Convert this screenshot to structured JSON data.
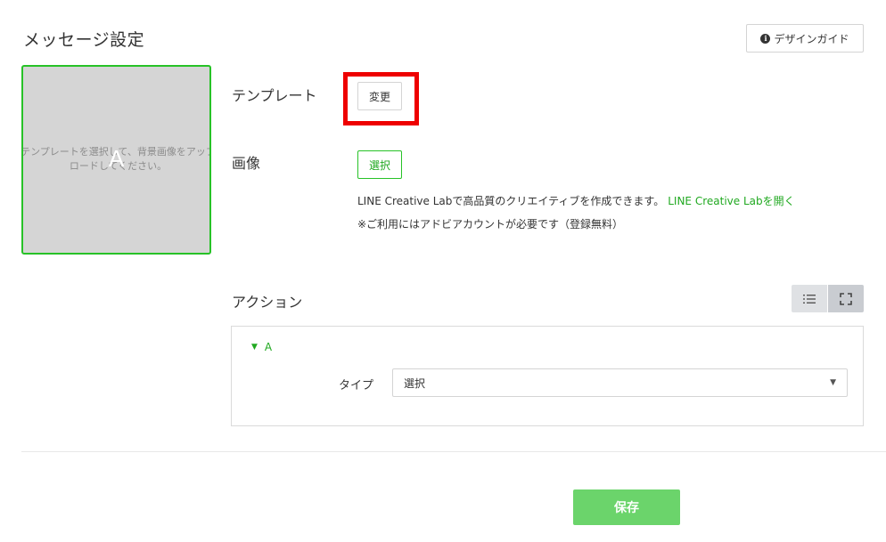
{
  "header": {
    "title": "メッセージ設定",
    "design_guide_label": "デザインガイド",
    "design_guide_icon": "info-icon"
  },
  "preview": {
    "hint": "テンプレートを選択して、背景画像をアップロードしてください。",
    "area_letter": "A"
  },
  "template": {
    "label": "テンプレート",
    "change_label": "変更"
  },
  "image": {
    "label": "画像",
    "select_label": "選択",
    "info_text": "LINE Creative Labで高品質のクリエイティブを作成できます。",
    "info_link": "LINE Creative Labを開く",
    "note": "※ご利用にはアドビアカウントが必要です（登録無料）"
  },
  "action": {
    "label": "アクション",
    "view_list_icon": "list-icon",
    "view_fullscreen_icon": "fullscreen-icon",
    "areas": [
      {
        "name": "A",
        "type_label": "タイプ",
        "type_value": "選択"
      }
    ]
  },
  "footer": {
    "save_label": "保存"
  },
  "colors": {
    "accent": "#27c227",
    "link": "#21a921",
    "highlight": "#ee0000",
    "save_button": "#6bd46b"
  }
}
